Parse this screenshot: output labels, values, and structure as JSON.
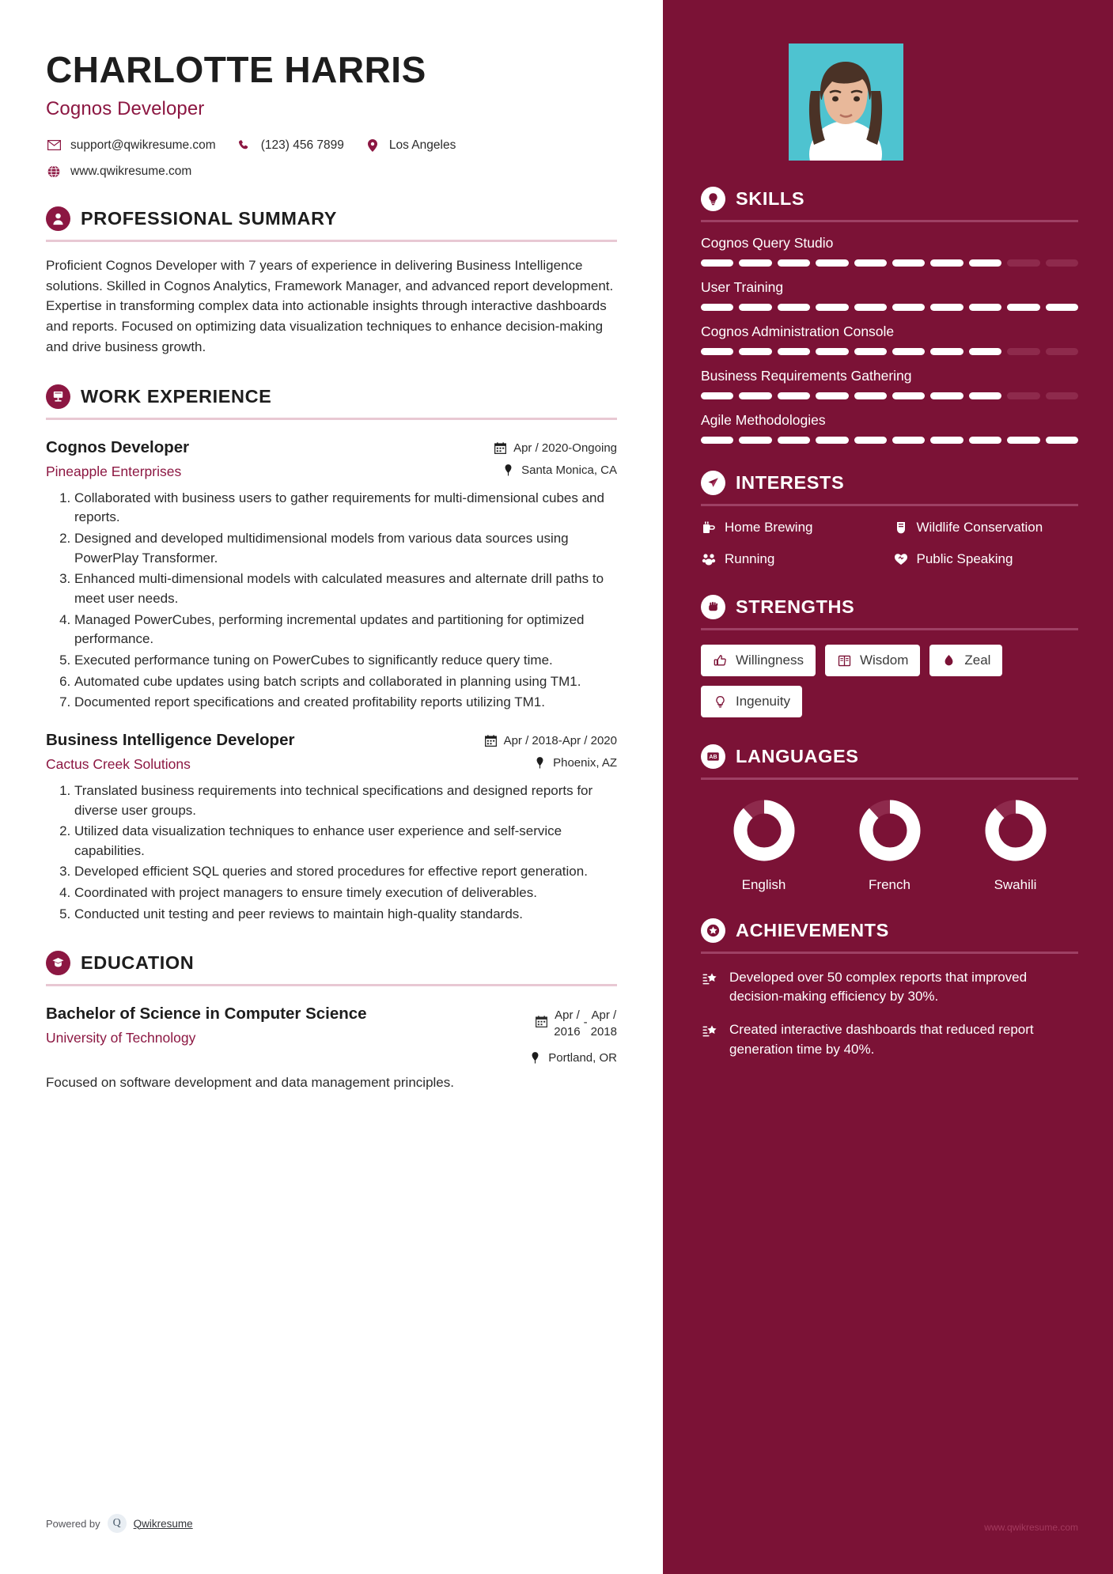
{
  "header": {
    "name": "CHARLOTTE HARRIS",
    "role": "Cognos Developer",
    "email": "support@qwikresume.com",
    "phone": "(123) 456 7899",
    "location": "Los Angeles",
    "website": "www.qwikresume.com"
  },
  "sections": {
    "summary_title": "PROFESSIONAL SUMMARY",
    "experience_title": "WORK EXPERIENCE",
    "education_title": "EDUCATION",
    "skills_title": "SKILLS",
    "interests_title": "INTERESTS",
    "strengths_title": "STRENGTHS",
    "languages_title": "LANGUAGES",
    "achievements_title": "ACHIEVEMENTS"
  },
  "summary": "Proficient Cognos Developer with 7 years of experience in delivering Business Intelligence solutions. Skilled in Cognos Analytics, Framework Manager, and advanced report development. Expertise in transforming complex data into actionable insights through interactive dashboards and reports. Focused on optimizing data visualization techniques to enhance decision-making and drive business growth.",
  "jobs": [
    {
      "title": "Cognos Developer",
      "company": "Pineapple Enterprises",
      "dates": "Apr / 2020-Ongoing",
      "location": "Santa Monica, CA",
      "bullets": [
        "Collaborated with business users to gather requirements for multi-dimensional cubes and reports.",
        "Designed and developed multidimensional models from various data sources using PowerPlay Transformer.",
        "Enhanced multi-dimensional models with calculated measures and alternate drill paths to meet user needs.",
        "Managed PowerCubes, performing incremental updates and partitioning for optimized performance.",
        "Executed performance tuning on PowerCubes to significantly reduce query time.",
        "Automated cube updates using batch scripts and collaborated in planning using TM1.",
        "Documented report specifications and created profitability reports utilizing TM1."
      ]
    },
    {
      "title": "Business Intelligence Developer",
      "company": "Cactus Creek Solutions",
      "dates": "Apr / 2018-Apr / 2020",
      "location": "Phoenix, AZ",
      "bullets": [
        "Translated business requirements into technical specifications and designed reports for diverse user groups.",
        "Utilized data visualization techniques to enhance user experience and self-service capabilities.",
        "Developed efficient SQL queries and stored procedures for effective report generation.",
        "Coordinated with project managers to ensure timely execution of deliverables.",
        "Conducted unit testing and peer reviews to maintain high-quality standards."
      ]
    }
  ],
  "education": {
    "degree": "Bachelor of Science in Computer Science",
    "school": "University of Technology",
    "date_start_line1": "Apr /",
    "date_start_line2": "2016",
    "date_end_line1": "Apr /",
    "date_end_line2": "2018",
    "location": "Portland, OR",
    "description": "Focused on software development and data management principles."
  },
  "skills": [
    {
      "name": "Cognos Query Studio",
      "filled": 8,
      "total": 10
    },
    {
      "name": "User Training",
      "filled": 10,
      "total": 10
    },
    {
      "name": "Cognos Administration Console",
      "filled": 8,
      "total": 10
    },
    {
      "name": "Business Requirements Gathering",
      "filled": 8,
      "total": 10
    },
    {
      "name": "Agile Methodologies",
      "filled": 10,
      "total": 10
    }
  ],
  "interests": [
    {
      "label": "Home Brewing",
      "icon": "brewing-icon"
    },
    {
      "label": "Wildlife Conservation",
      "icon": "wildlife-icon"
    },
    {
      "label": "Running",
      "icon": "running-icon"
    },
    {
      "label": "Public Speaking",
      "icon": "speaking-icon"
    }
  ],
  "strengths": [
    {
      "label": "Willingness",
      "icon": "thumbs-up-icon"
    },
    {
      "label": "Wisdom",
      "icon": "book-icon"
    },
    {
      "label": "Zeal",
      "icon": "flame-icon"
    },
    {
      "label": "Ingenuity",
      "icon": "bulb-icon"
    }
  ],
  "languages": [
    {
      "label": "English",
      "percent": 88
    },
    {
      "label": "French",
      "percent": 88
    },
    {
      "label": "Swahili",
      "percent": 88
    }
  ],
  "achievements": [
    "Developed over 50 complex reports that improved decision-making efficiency by 30%.",
    "Created interactive dashboards that reduced report generation time by 40%."
  ],
  "footer": {
    "powered_by": "Powered by",
    "brand": "Qwikresume",
    "watermark": "www.qwikresume.com"
  },
  "colors": {
    "accent": "#8c1742",
    "sidebar": "#7b1236",
    "rule": "#e8c8d3",
    "photo_bg": "#4ec3d0"
  }
}
